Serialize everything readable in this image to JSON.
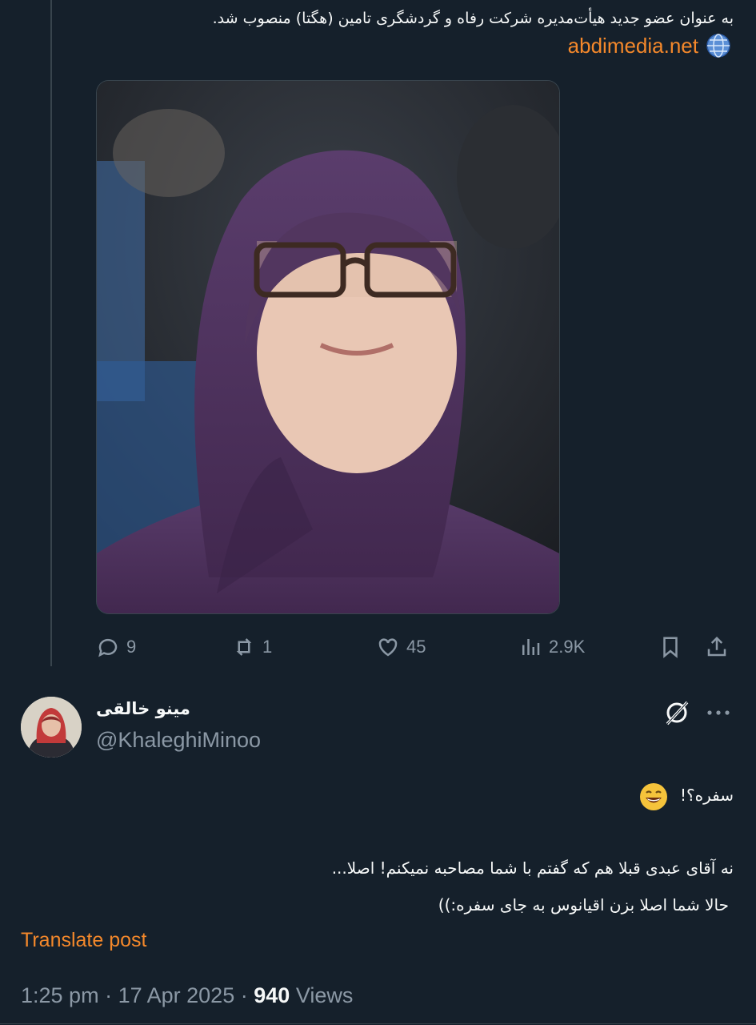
{
  "parent": {
    "text": "به عنوان عضو جدید هیأت‌مدیره شرکت رفاه و گردشگری تامین (هگتا) منصوب شد.",
    "link": "abdimedia.net",
    "actions": {
      "replies": "9",
      "reposts": "1",
      "likes": "45",
      "views": "2.9K"
    }
  },
  "reply": {
    "author_name": "مینو خالقی",
    "author_handle": "@KhaleghiMinoo",
    "line1": "سفره؟!",
    "line2": "نه آقای عبدی قبلا هم که گفتم با شما مصاحبه نمیکنم! اصلا...",
    "line3": "حالا شما اصلا بزن اقیانوس به جای سفره:))",
    "translate": "Translate post",
    "time": "1:25 pm",
    "date": "17 Apr 2025",
    "views_count": "940",
    "views_label": "Views"
  },
  "colors": {
    "background": "#15202b",
    "accent": "#f4882b",
    "muted": "#8b98a5"
  },
  "icons": [
    "globe-icon",
    "reply-icon",
    "repost-icon",
    "like-icon",
    "views-icon",
    "bookmark-icon",
    "share-icon",
    "grok-icon",
    "more-icon",
    "grinning-emoji-icon"
  ]
}
